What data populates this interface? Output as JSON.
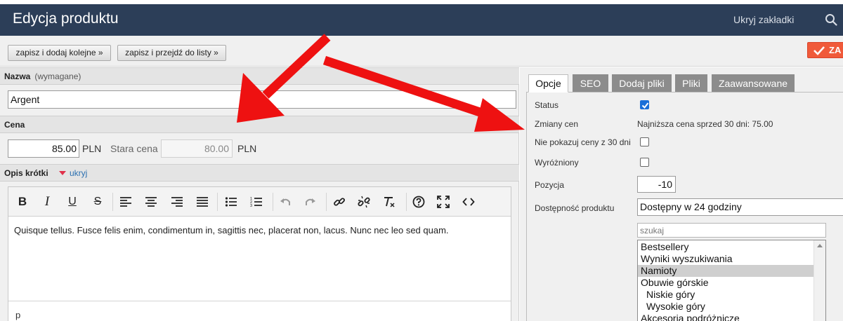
{
  "header": {
    "title": "Edycja produktu",
    "hide_tabs_label": "Ukryj zakładki",
    "search_icon": "search-icon"
  },
  "toolbar": {
    "save_add_label": "zapisz i dodaj kolejne »",
    "save_list_label": "zapisz i przejdź do listy »",
    "save_main_label": "ZA",
    "save_main_color": "#f05a3a"
  },
  "form": {
    "name_label": "Nazwa",
    "name_note": "(wymagane)",
    "name_value": "Argent",
    "price_label": "Cena",
    "price_value": "85.00",
    "currency": "PLN",
    "old_price_label": "Stara cena",
    "old_price_value": "80.00",
    "old_price_currency": "PLN",
    "short_desc_label": "Opis krótki",
    "hide_label": "ukryj"
  },
  "editor": {
    "toolbar_icons": [
      "bold-icon",
      "italic-icon",
      "underline-icon",
      "strikethrough-icon",
      "align-left-icon",
      "align-center-icon",
      "align-right-icon",
      "justify-icon",
      "bullet-list-icon",
      "numbered-list-icon",
      "undo-icon",
      "redo-icon",
      "link-icon",
      "unlink-icon",
      "clear-format-icon",
      "help-icon",
      "fullscreen-icon",
      "code-icon"
    ],
    "content": "Quisque tellus. Fusce felis enim, condimentum in, sagittis nec, placerat non, lacus. Nunc nec leo sed quam.",
    "path": "p"
  },
  "tabs": [
    {
      "label": "Opcje",
      "active": true
    },
    {
      "label": "SEO",
      "active": false
    },
    {
      "label": "Dodaj pliki",
      "active": false
    },
    {
      "label": "Pliki",
      "active": false
    },
    {
      "label": "Zaawansowane",
      "active": false
    }
  ],
  "options": {
    "status_label": "Status",
    "status_checked": true,
    "price_changes_label": "Zmiany cen",
    "price_changes_value": "Najniższa cena sprzed 30 dni: 75.00",
    "hide_30_label": "Nie pokazuj ceny z 30 dni",
    "hide_30_checked": false,
    "featured_label": "Wyróżniony",
    "featured_checked": false,
    "position_label": "Pozycja",
    "position_value": "-10",
    "availability_label": "Dostępność produktu",
    "availability_value": "Dostępny w 24 godziny",
    "search_placeholder": "szukaj",
    "categories": [
      {
        "label": "Bestsellery",
        "selected": false,
        "indent": false
      },
      {
        "label": "Wyniki wyszukiwania",
        "selected": false,
        "indent": false
      },
      {
        "label": "Namioty",
        "selected": true,
        "indent": false
      },
      {
        "label": "Obuwie górskie",
        "selected": false,
        "indent": false
      },
      {
        "label": "Niskie góry",
        "selected": false,
        "indent": true
      },
      {
        "label": "Wysokie góry",
        "selected": false,
        "indent": true
      },
      {
        "label": "Akcesoria podróżnicze",
        "selected": false,
        "indent": false
      }
    ]
  },
  "colors": {
    "header_bg": "#2c3e58",
    "checkbox_blue": "#1a6fd8",
    "arrow_red": "#ee1111"
  }
}
